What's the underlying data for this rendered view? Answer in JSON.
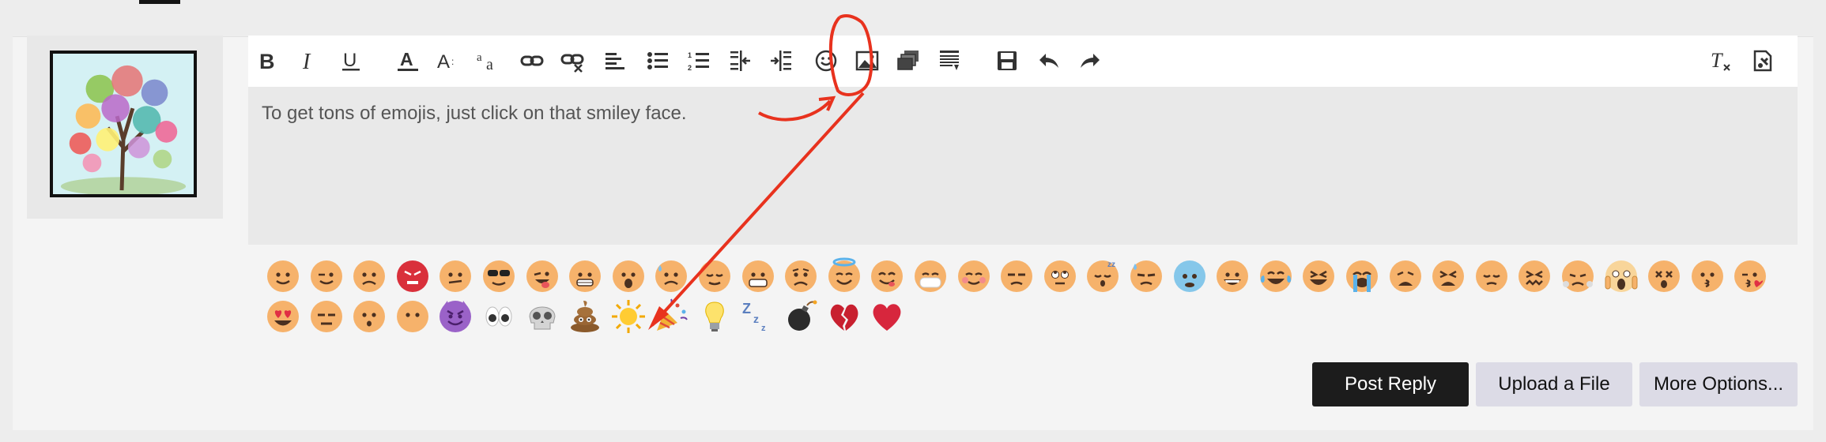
{
  "editor": {
    "content_text": "To get tons of emojis, just click on that smiley face."
  },
  "toolbar": {
    "buttons": [
      {
        "icon": "bold-icon"
      },
      {
        "icon": "italic-icon"
      },
      {
        "icon": "underline-icon"
      },
      {
        "icon": "text-color-icon"
      },
      {
        "icon": "font-size-icon"
      },
      {
        "icon": "font-family-icon"
      },
      {
        "icon": "link-icon"
      },
      {
        "icon": "unlink-icon"
      },
      {
        "icon": "align-left-icon"
      },
      {
        "icon": "bulleted-list-icon"
      },
      {
        "icon": "numbered-list-icon"
      },
      {
        "icon": "outdent-icon"
      },
      {
        "icon": "indent-icon"
      },
      {
        "icon": "smiley-icon"
      },
      {
        "icon": "image-icon"
      },
      {
        "icon": "media-icon"
      },
      {
        "icon": "insert-template-icon"
      },
      {
        "icon": "save-draft-icon"
      },
      {
        "icon": "undo-icon"
      },
      {
        "icon": "redo-icon"
      },
      {
        "icon": "remove-formatting-icon"
      },
      {
        "icon": "toggle-bbcode-icon"
      }
    ]
  },
  "emojis": [
    "slightly-smiling",
    "winking",
    "frowning",
    "angry-red",
    "confused",
    "sunglasses",
    "tongue-wink",
    "grimacing-teeth",
    "astonished",
    "cold-sweat",
    "relieved",
    "grinning-teeth",
    "worried",
    "halo-innocent",
    "yum",
    "mask",
    "blushing",
    "unamused",
    "rolling-eyes",
    "sleeping",
    "downcast",
    "anxious-blue",
    "grinning",
    "tears-of-joy",
    "laughing",
    "crying-loud",
    "weary",
    "tired",
    "pensive",
    "confounded",
    "triumph",
    "screaming",
    "dizzy",
    "kissing",
    "kissing-heart",
    "heart-eyes",
    "expressionless",
    "hushed",
    "no-mouth",
    "imp",
    "eyes",
    "skull",
    "poop",
    "sun",
    "party-popper",
    "light-bulb",
    "zzz",
    "bomb",
    "broken-heart",
    "red-heart"
  ],
  "buttons": {
    "post_reply": "Post Reply",
    "upload_file": "Upload a File",
    "more_options": "More Options..."
  },
  "colors": {
    "primary_button": "#1c1c1c",
    "secondary_button": "#dcdbe6",
    "annotation": "#e8321e",
    "emoji_face": "#f6b26b"
  }
}
